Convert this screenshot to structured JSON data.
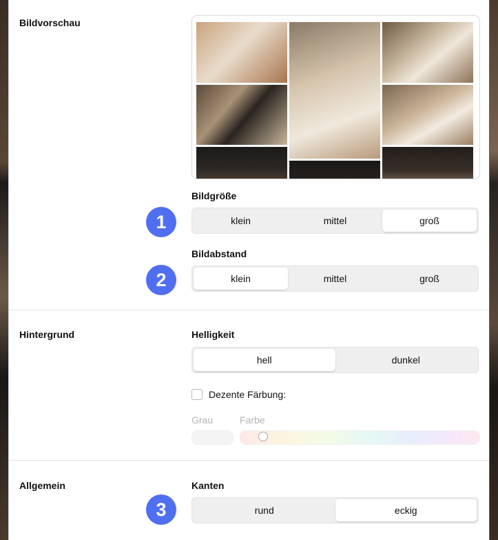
{
  "sections": {
    "preview_label": "Bildvorschau",
    "background_label": "Hintergrund",
    "general_label": "Allgemein"
  },
  "image_size": {
    "label": "Bildgröße",
    "badge": "1",
    "options": [
      "klein",
      "mittel",
      "groß"
    ],
    "selected": "groß"
  },
  "image_spacing": {
    "label": "Bildabstand",
    "badge": "2",
    "options": [
      "klein",
      "mittel",
      "groß"
    ],
    "selected": "klein"
  },
  "brightness": {
    "label": "Helligkeit",
    "options": [
      "hell",
      "dunkel"
    ],
    "selected": "hell"
  },
  "tint": {
    "checkbox_label": "Dezente Färbung:",
    "checked": false,
    "gray_label": "Grau",
    "color_label": "Farbe"
  },
  "edges": {
    "label": "Kanten",
    "badge": "3",
    "options": [
      "rund",
      "eckig"
    ],
    "selected": "eckig"
  },
  "colors": {
    "badge": "#4f6ff0",
    "muted_text": "#b3b3b3"
  }
}
